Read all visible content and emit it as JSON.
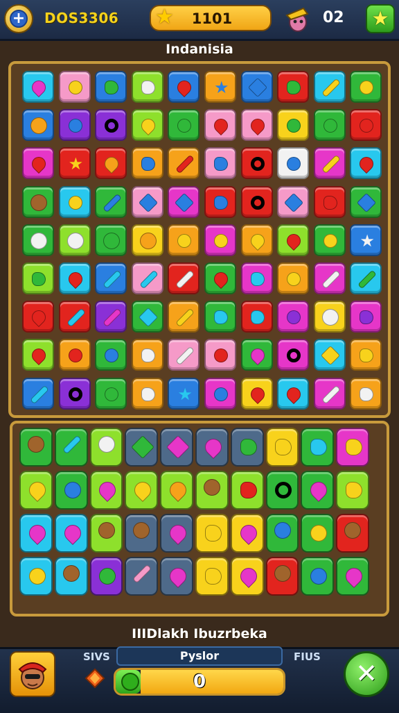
{
  "header": {
    "game_id": "DOS3306",
    "score": "1101",
    "moves": "02",
    "colors": {
      "score_pill": "#f6b624",
      "accent_green": "#3fbf2a",
      "plus_blue": "#2d66c8"
    }
  },
  "level_title": "Indanisia",
  "board": {
    "rows": 9,
    "cols": 10,
    "tiles": [
      [
        "cyan:drop:magenta",
        "pink:circle:yellow",
        "blue:blob:green",
        "lime:blob:white",
        "blue:heart:red",
        "orange:star:blue",
        "blue:diamond:blue",
        "red:blob:green",
        "cyan:bar:yellow",
        "green:circle:yellow"
      ],
      [
        "blue:face:orange",
        "purple:circle:blue",
        "purple:ring:white",
        "lime:heart:yellow",
        "green:circle:green",
        "pink:heart:red",
        "pink:heart:red",
        "yellow:circle:green",
        "green:circle:green",
        "red:circle:red"
      ],
      [
        "magenta:heart:red",
        "red:star:yellow",
        "red:heart:orange",
        "orange:blob:blue",
        "orange:bar:red",
        "pink:blob:blue",
        "red:ring:yellow",
        "white:circle:blue",
        "magenta:bar:yellow",
        "cyan:heart:red"
      ],
      [
        "green:face:brown",
        "cyan:circle:yellow",
        "green:bar:blue",
        "pink:diamond:blue",
        "magenta:diamond:blue",
        "red:blob:blue",
        "red:ring:white",
        "pink:diamond:blue",
        "red:blob:red",
        "green:diamond:blue"
      ],
      [
        "green:face:white",
        "lime:face:white",
        "green:face:green",
        "yellow:face:orange",
        "orange:circle:yellow",
        "magenta:circle:yellow",
        "orange:heart:yellow",
        "lime:heart:red",
        "green:circle:yellow",
        "blue:star:white"
      ],
      [
        "lime:blob:green",
        "cyan:heart:red",
        "blue:bar:cyan",
        "pink:bar:cyan",
        "red:bar:white",
        "green:heart:red",
        "magenta:blob:cyan",
        "orange:circle:yellow",
        "magenta:bar:white",
        "cyan:bar:green"
      ],
      [
        "red:heart:red",
        "red:bar:cyan",
        "purple:bar:magenta",
        "green:diamond:cyan",
        "orange:bar:yellow",
        "green:blob:cyan",
        "red:blob:cyan",
        "magenta:circle:purple",
        "yellow:face:white",
        "magenta:blob:purple"
      ],
      [
        "lime:drop:red",
        "orange:circle:red",
        "green:circle:blue",
        "orange:blob:white",
        "pink:bar:white",
        "pink:circle:red",
        "green:drop:magenta",
        "magenta:ring:blue",
        "cyan:diamond:yellow",
        "orange:blob:yellow"
      ],
      [
        "blue:bar:cyan",
        "purple:ring:white",
        "green:circle:green",
        "orange:blob:white",
        "blue:star:cyan",
        "magenta:circle:blue",
        "yellow:heart:red",
        "cyan:heart:red",
        "magenta:bar:white",
        "orange:blob:white"
      ]
    ]
  },
  "tray": {
    "tiles": [
      [
        "green:face:brown",
        "green:bar:cyan",
        "lime:face:white",
        "slate:diamond:green",
        "slate:diamond:magenta",
        "slate:heart:magenta",
        "slate:blob:green",
        "yellow:blob:yellow",
        "green:blob:cyan",
        "magenta:blob:yellow"
      ],
      [
        "lime:drop:yellow",
        "green:circle:blue",
        "lime:heart:magenta",
        "lime:heart:yellow",
        "lime:heart:orange",
        "lime:face:brown",
        "lime:blob:red",
        "green:ring:cyan",
        "green:heart:magenta",
        "lime:blob:yellow"
      ],
      [
        "cyan:heart:magenta",
        "cyan:heart:magenta",
        "lime:face:brown",
        "slate:face:brown",
        "slate:heart:magenta",
        "yellow:blob:yellow",
        "yellow:heart:magenta",
        "green:face:blue",
        "green:circle:yellow",
        "red:face:brown"
      ],
      [
        "cyan:circle:yellow",
        "cyan:face:brown",
        "purple:circle:green",
        "slate:bar:pink",
        "slate:heart:magenta",
        "yellow:blob:yellow",
        "yellow:heart:magenta",
        "red:face:brown",
        "green:circle:blue",
        "green:heart:magenta"
      ]
    ]
  },
  "footer": {
    "title": "IIIDlakh Ibuzrbeka",
    "left_label": "SIVS",
    "right_label": "FIUS",
    "player_label": "Pyslor",
    "progress_value": "0",
    "progress_fraction": 0.15,
    "icons": {
      "profile": "player-portrait-icon",
      "gem": "gem-icon",
      "leaf": "leaf-icon",
      "confirm": "close-x-icon"
    }
  },
  "palette": {
    "cyan": "#28c8ee",
    "pink": "#f59ac8",
    "blue": "#2a7fe0",
    "lime": "#8ee02c",
    "red": "#e2241e",
    "orange": "#f6a21a",
    "green": "#30b83a",
    "purple": "#8a30d6",
    "magenta": "#e636c8",
    "yellow": "#f8d21c",
    "white": "#f2f2f2",
    "brown": "#a0642c",
    "slate": "#4e6a8a"
  }
}
